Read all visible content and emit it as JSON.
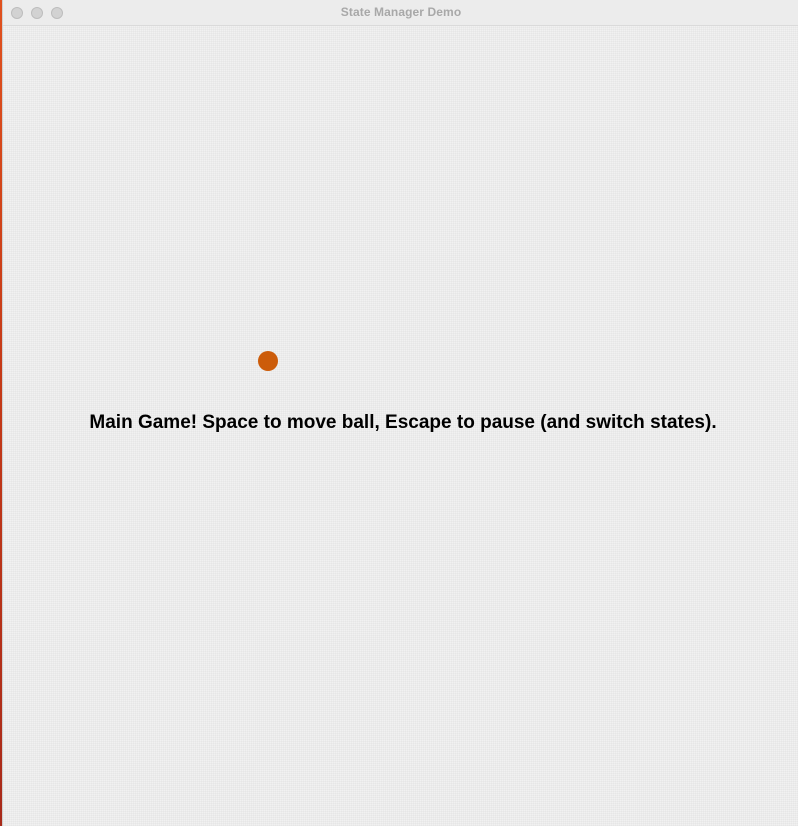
{
  "window": {
    "title": "State Manager Demo",
    "controls": {
      "close": "close-button",
      "minimize": "minimize-button",
      "zoom": "zoom-button"
    }
  },
  "game": {
    "state": "main-game",
    "instructions": "Main Game! Space to move ball, Escape to pause (and switch states).",
    "ball_color": "#cc5c0a",
    "background_color": "#f1f1f1"
  }
}
